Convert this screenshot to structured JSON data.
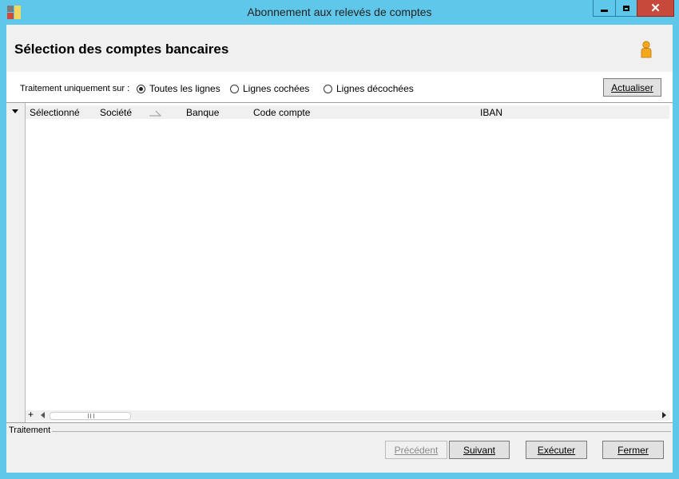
{
  "window": {
    "title": "Abonnement aux relevés de comptes",
    "minimize_icon": "minimize-icon",
    "maximize_icon": "maximize-icon",
    "close_glyph": "✕"
  },
  "header": {
    "title": "Sélection des comptes bancaires",
    "user_icon": "user-icon"
  },
  "filter": {
    "label": "Traitement uniquement sur :",
    "options": [
      {
        "label": "Toutes les lignes",
        "checked": true
      },
      {
        "label": "Lignes cochées",
        "checked": false
      },
      {
        "label": "Lignes décochées",
        "checked": false
      }
    ],
    "refresh_label": "Actualiser"
  },
  "grid": {
    "columns": [
      "Sélectionné",
      "Société",
      "Banque",
      "Code compte",
      "IBAN"
    ],
    "rows": [],
    "add_label": "+"
  },
  "footer": {
    "section_label": "Traitement",
    "buttons": {
      "previous": "Précédent",
      "next": "Suivant",
      "execute": "Exécuter",
      "close": "Fermer"
    }
  },
  "colors": {
    "frame": "#5fc8ea",
    "close_button": "#c7493b",
    "panel": "#f0f0f0"
  }
}
